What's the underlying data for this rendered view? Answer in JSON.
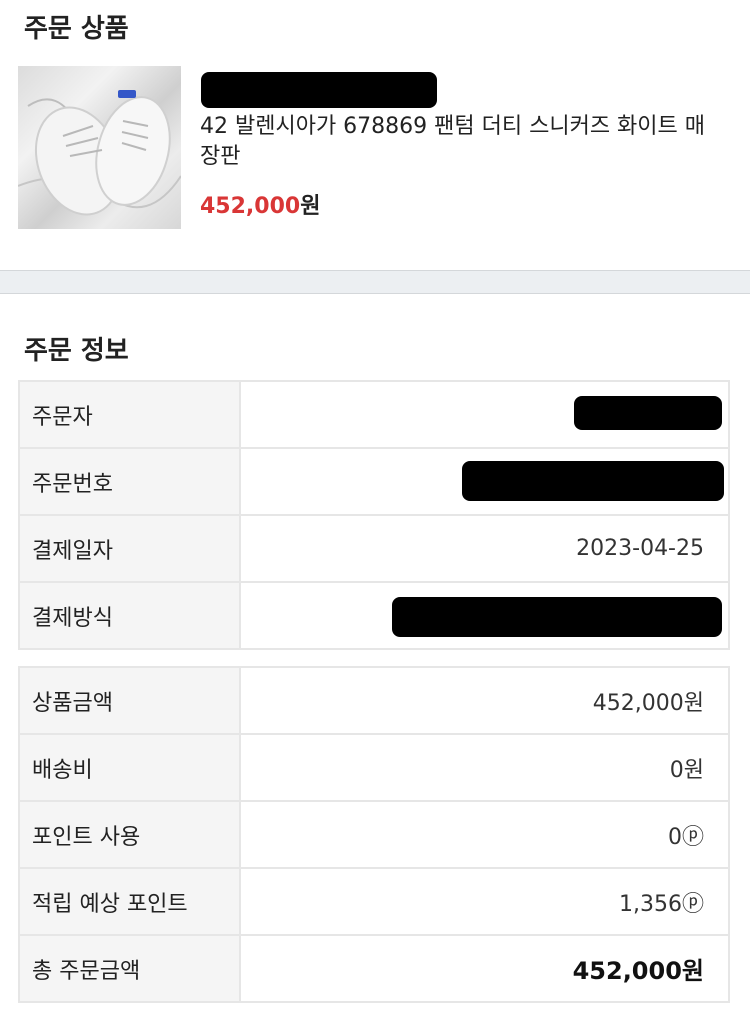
{
  "order_product": {
    "title": "주문 상품",
    "image_alt": "white sneakers on marble background",
    "name": "42 발렌시아가 678869 팬텀 더티 스니커즈 화이트 매장판",
    "price_number": "452,000",
    "price_unit": "원"
  },
  "order_info": {
    "title": "주문 정보",
    "rows": [
      {
        "label": "주문자",
        "value": ""
      },
      {
        "label": "주문번호",
        "value": ""
      },
      {
        "label": "결제일자",
        "value": "2023-04-25"
      },
      {
        "label": "결제방식",
        "value": ""
      }
    ]
  },
  "payment": {
    "rows": [
      {
        "label": "상품금액",
        "value": "452,000원"
      },
      {
        "label": "배송비",
        "value": "0원"
      },
      {
        "label": "포인트 사용",
        "value": "0ⓟ"
      },
      {
        "label": "적립 예상 포인트",
        "value": "1,356ⓟ"
      },
      {
        "label": "총 주문금액",
        "value": "452,000원"
      }
    ]
  },
  "colors": {
    "price_red": "#d93636",
    "label_bg": "#f5f5f5",
    "border": "#e6e6e6",
    "divider_bg": "#eceff2"
  }
}
